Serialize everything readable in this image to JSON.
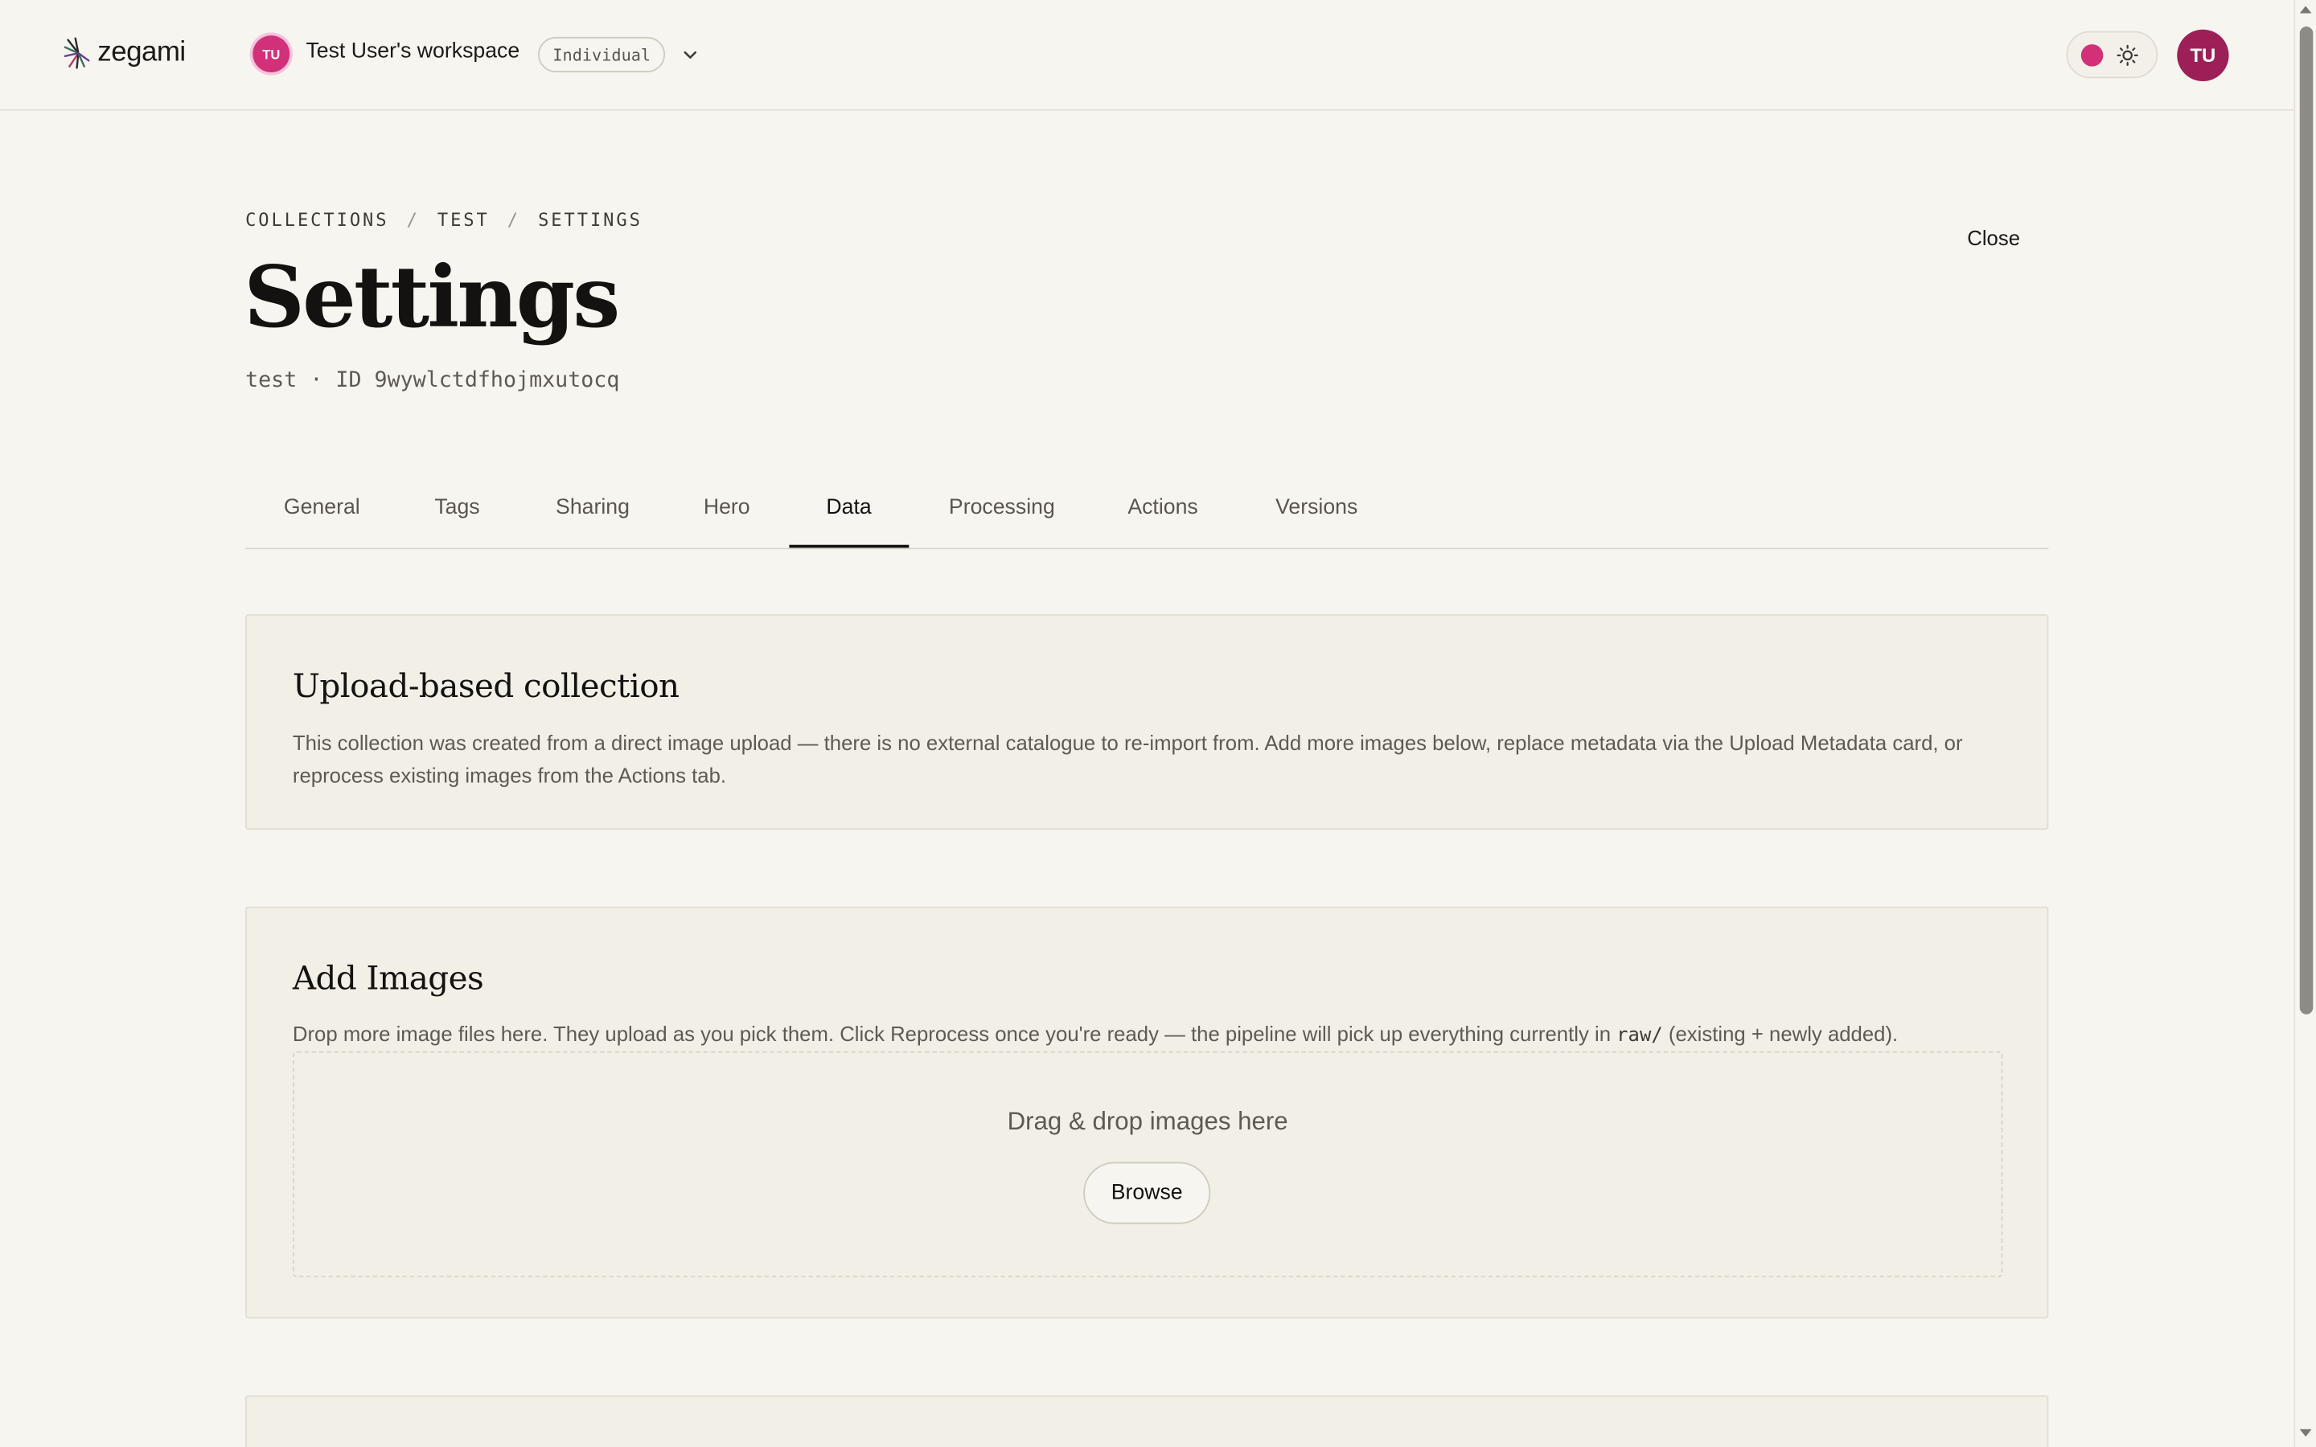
{
  "header": {
    "logo_text": "zegami",
    "workspace_initials": "TU",
    "workspace_name": "Test User's workspace",
    "plan_badge": "Individual",
    "user_initials": "TU"
  },
  "breadcrumb": [
    "COLLECTIONS",
    "TEST",
    "SETTINGS"
  ],
  "breadcrumb_sep": "/",
  "close_label": "Close",
  "page_title": "Settings",
  "subtitle": "test · ID 9wywlctdfhojmxutocq",
  "tabs": [
    {
      "label": "General",
      "active": false
    },
    {
      "label": "Tags",
      "active": false
    },
    {
      "label": "Sharing",
      "active": false
    },
    {
      "label": "Hero",
      "active": false
    },
    {
      "label": "Data",
      "active": true
    },
    {
      "label": "Processing",
      "active": false
    },
    {
      "label": "Actions",
      "active": false
    },
    {
      "label": "Versions",
      "active": false
    }
  ],
  "upload_card": {
    "title": "Upload-based collection",
    "body": "This collection was created from a direct image upload — there is no external catalogue to re-import from. Add more images below, replace metadata via the Upload Metadata card, or reprocess existing images from the Actions tab."
  },
  "add_images_card": {
    "title": "Add Images",
    "body_before": "Drop more image files here. They upload as you pick them. Click Reprocess once you're ready — the pipeline will pick up everything currently in ",
    "body_code": "raw/",
    "body_after": " (existing + newly added).",
    "drop_text": "Drag & drop images here",
    "browse_label": "Browse"
  },
  "colors": {
    "background": "#f7f5ef",
    "card": "#f2efe7",
    "accent_pink": "#d2317a",
    "user_avatar": "#9d1f58",
    "text": "#141210"
  }
}
